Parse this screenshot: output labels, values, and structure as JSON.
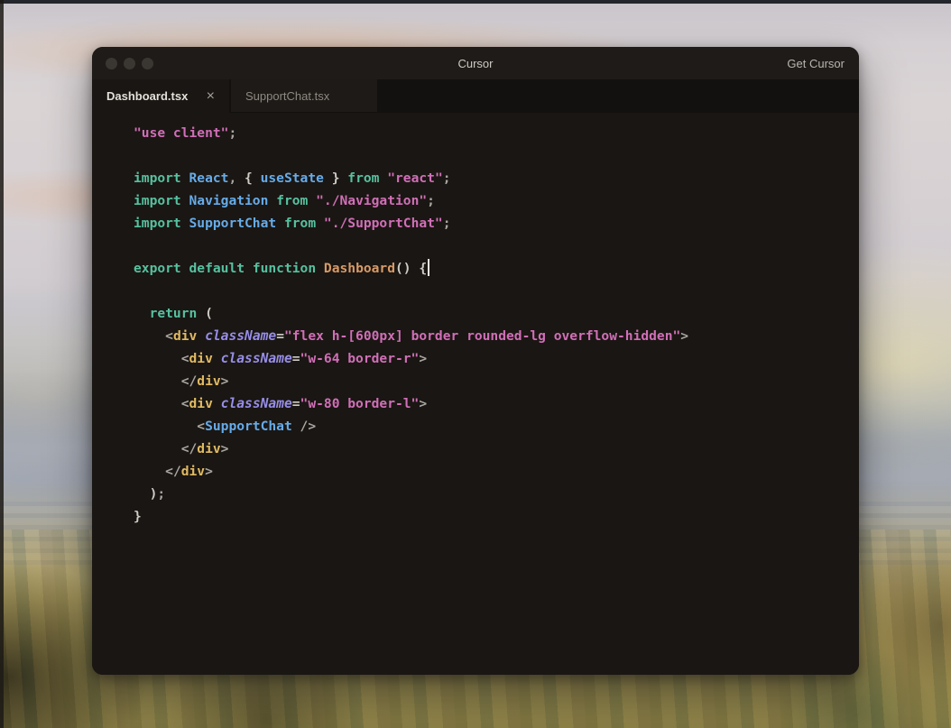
{
  "palette": {
    "editor_bg": "#1a1613",
    "titlebar_bg": "#1f1b18",
    "tabbar_bg": "#131110",
    "inactive_tab_bg": "#1e1a17",
    "keyword": "#56c1a0",
    "identifier": "#66abe8",
    "function_name": "#d79a67",
    "string": "#d06fb7",
    "tag": "#e0ba62",
    "attribute": "#978ee8",
    "punctuation": "#a9a5a0",
    "bracket": "#cfccc6"
  },
  "window": {
    "title": "Cursor",
    "get_cursor_label": "Get Cursor"
  },
  "tabs": [
    {
      "label": "Dashboard.tsx",
      "active": true,
      "close_icon": "×"
    },
    {
      "label": "SupportChat.tsx",
      "active": false
    }
  ],
  "editor": {
    "language": "tsx",
    "lines": [
      [
        [
          "str",
          "\"use client\""
        ],
        [
          "pun",
          ";"
        ]
      ],
      [],
      [
        [
          "kw",
          "import"
        ],
        [
          "pln",
          " "
        ],
        [
          "var",
          "React"
        ],
        [
          "pun",
          ", "
        ],
        [
          "br",
          "{ "
        ],
        [
          "var",
          "useState"
        ],
        [
          "br",
          " }"
        ],
        [
          "pln",
          " "
        ],
        [
          "kw",
          "from"
        ],
        [
          "pln",
          " "
        ],
        [
          "str",
          "\"react\""
        ],
        [
          "pun",
          ";"
        ]
      ],
      [
        [
          "kw",
          "import"
        ],
        [
          "pln",
          " "
        ],
        [
          "var",
          "Navigation"
        ],
        [
          "pln",
          " "
        ],
        [
          "kw",
          "from"
        ],
        [
          "pln",
          " "
        ],
        [
          "str",
          "\"./Navigation\""
        ],
        [
          "pun",
          ";"
        ]
      ],
      [
        [
          "kw",
          "import"
        ],
        [
          "pln",
          " "
        ],
        [
          "var",
          "SupportChat"
        ],
        [
          "pln",
          " "
        ],
        [
          "kw",
          "from"
        ],
        [
          "pln",
          " "
        ],
        [
          "str",
          "\"./SupportChat\""
        ],
        [
          "pun",
          ";"
        ]
      ],
      [],
      [
        [
          "kw",
          "export"
        ],
        [
          "pln",
          " "
        ],
        [
          "kw",
          "default"
        ],
        [
          "pln",
          " "
        ],
        [
          "kw",
          "function"
        ],
        [
          "pln",
          " "
        ],
        [
          "fn",
          "Dashboard"
        ],
        [
          "br",
          "()"
        ],
        [
          "pln",
          " "
        ],
        [
          "br",
          "{"
        ],
        [
          "caret",
          ""
        ]
      ],
      [],
      [
        [
          "pln",
          "  "
        ],
        [
          "kw",
          "return"
        ],
        [
          "pln",
          " "
        ],
        [
          "br",
          "("
        ]
      ],
      [
        [
          "pln",
          "    "
        ],
        [
          "ang",
          "<"
        ],
        [
          "tag",
          "div"
        ],
        [
          "pln",
          " "
        ],
        [
          "attr",
          "className"
        ],
        [
          "br",
          "="
        ],
        [
          "str",
          "\"flex h-[600px] border rounded-lg overflow-hidden\""
        ],
        [
          "ang",
          ">"
        ]
      ],
      [
        [
          "pln",
          "      "
        ],
        [
          "ang",
          "<"
        ],
        [
          "tag",
          "div"
        ],
        [
          "pln",
          " "
        ],
        [
          "attr",
          "className"
        ],
        [
          "br",
          "="
        ],
        [
          "str",
          "\"w-64 border-r\""
        ],
        [
          "ang",
          ">"
        ]
      ],
      [
        [
          "pln",
          "      "
        ],
        [
          "ang",
          "</"
        ],
        [
          "tag",
          "div"
        ],
        [
          "ang",
          ">"
        ]
      ],
      [
        [
          "pln",
          "      "
        ],
        [
          "ang",
          "<"
        ],
        [
          "tag",
          "div"
        ],
        [
          "pln",
          " "
        ],
        [
          "attr",
          "className"
        ],
        [
          "br",
          "="
        ],
        [
          "str",
          "\"w-80 border-l\""
        ],
        [
          "ang",
          ">"
        ]
      ],
      [
        [
          "pln",
          "        "
        ],
        [
          "ang",
          "<"
        ],
        [
          "var",
          "SupportChat"
        ],
        [
          "pln",
          " "
        ],
        [
          "ang",
          "/>"
        ]
      ],
      [
        [
          "pln",
          "      "
        ],
        [
          "ang",
          "</"
        ],
        [
          "tag",
          "div"
        ],
        [
          "ang",
          ">"
        ]
      ],
      [
        [
          "pln",
          "    "
        ],
        [
          "ang",
          "</"
        ],
        [
          "tag",
          "div"
        ],
        [
          "ang",
          ">"
        ]
      ],
      [
        [
          "pln",
          "  "
        ],
        [
          "br",
          ")"
        ],
        [
          "pun",
          ";"
        ]
      ],
      [
        [
          "br",
          "}"
        ]
      ]
    ]
  }
}
